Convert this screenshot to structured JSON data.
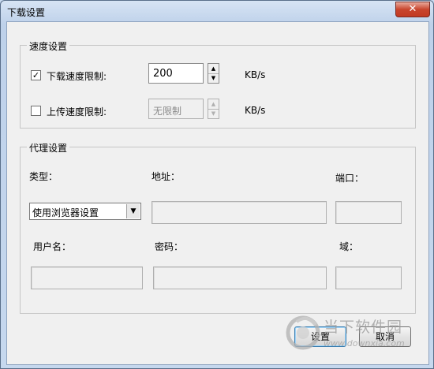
{
  "window": {
    "title": "下载设置",
    "close_glyph": "✕"
  },
  "speed_group": {
    "legend": "速度设置",
    "download_limit": {
      "checked_glyph": "✓",
      "label": "下载速度限制:",
      "value": "200",
      "unit": "KB/s"
    },
    "upload_limit": {
      "checked_glyph": "",
      "label": "上传速度限制:",
      "value": "无限制",
      "unit": "KB/s"
    }
  },
  "proxy_group": {
    "legend": "代理设置",
    "type_label": "类型：",
    "address_label": "地址：",
    "port_label": "端口：",
    "type_value": "使用浏览器设置",
    "username_label": "用户名：",
    "password_label": "密码：",
    "domain_label": "域："
  },
  "buttons": {
    "ok_label": "设置",
    "cancel_label": "取消"
  },
  "watermark": {
    "logo_text": "当下软件园",
    "url": "www.downxia.com"
  }
}
